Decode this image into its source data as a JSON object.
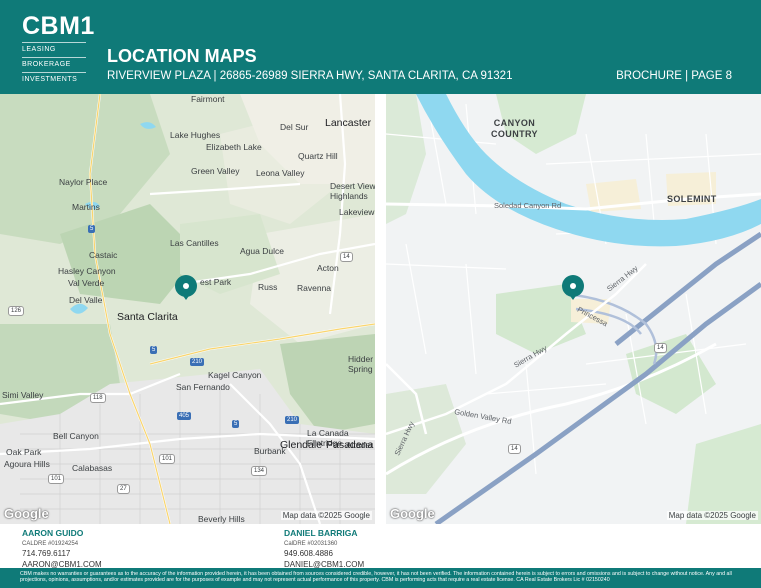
{
  "header": {
    "logo": "CBM1",
    "logo_lines": [
      "LEASING",
      "BROKERAGE",
      "INVESTMENTS"
    ],
    "title": "LOCATION MAPS",
    "subtitle": "RIVERVIEW PLAZA | 26865-26989 SIERRA HWY, SANTA CLARITA, CA 91321",
    "page_label": "BROCHURE | PAGE 8"
  },
  "map_left": {
    "labels": {
      "fairmont": "Fairmont",
      "lancaster": "Lancaster",
      "delsur": "Del Sur",
      "lakehughes": "Lake Hughes",
      "elizabethlake": "Elizabeth Lake",
      "quartzhill": "Quartz Hill",
      "greenvalley": "Green Valley",
      "leonavalley": "Leona Valley",
      "naylorplace": "Naylor Place",
      "desertview": "Desert View\nHighlands",
      "martins": "Martins",
      "lakeview": "Lakeview",
      "lascantilles": "Las Cantilles",
      "aguadulce": "Agua Dulce",
      "castaic": "Castaic",
      "acton": "Acton",
      "hasleycanyon": "Hasley Canyon",
      "forestpark": "est Park",
      "valverde": "Val Verde",
      "russ": "Russ",
      "ravenna": "Ravenna",
      "delvalle": "Del Valle",
      "santaclarita": "Santa Clarita",
      "hidden": "Hidder\nSpring",
      "kagelcanyon": "Kagel Canyon",
      "sanfernando": "San Fernando",
      "simivalley": "Simi Valley",
      "bellcanyon": "Bell Canyon",
      "lacanada": "La Canada\nFlintridge",
      "altadena": "Altader",
      "oakpark": "Oak Park",
      "agourahills": "Agoura Hills",
      "burbank": "Burbank",
      "calabasas": "Calabasas",
      "glendale": "Glendale",
      "pasadena": "Pasadena",
      "beverlyhills": "Beverly Hills"
    },
    "shields": {
      "s5a": "5",
      "s14": "14",
      "s126": "126",
      "s5b": "5",
      "s210": "210",
      "s118": "118",
      "s405": "405",
      "s5c": "5",
      "s210b": "210",
      "s101": "101",
      "s134": "134",
      "s101b": "101",
      "s27": "27"
    },
    "google": "Google",
    "attribution": "Map data ©2025 Google"
  },
  "map_right": {
    "labels": {
      "canyoncountry": "CANYON\nCOUNTRY",
      "solemint": "SOLEMINT",
      "soledad": "Soledad Canyon Rd",
      "sierrahwy1": "Sierra Hwy",
      "princessa": "Princessa",
      "sierrahwy2": "Sierra Hwy",
      "goldenvalley": "Golden Valley Rd",
      "sierrahwy3": "Sierra Hwy"
    },
    "shields": {
      "r14a": "14",
      "r14b": "14"
    },
    "google": "Google",
    "attribution": "Map data ©2025 Google"
  },
  "contacts": [
    {
      "name": "AARON GUIDO",
      "license": "CALDRE #01924254",
      "phone": "714.769.6117",
      "email": "AARON@CBM1.COM"
    },
    {
      "name": "DANIEL BARRIGA",
      "license": "CalDRE #02031360",
      "phone": "949.608.4886",
      "email": "DANIEL@CBM1.COM"
    }
  ],
  "footer": {
    "disclaimer": "CBM makes no warranties or guarantees as to the accuracy of the information provided herein, it has been obtained from sources considered credible, however, it has not been verified. The information contained herein is subject to errors and omissions and is subject to change without notice. Any and all projections, opinions, assumptions, and/or estimates provided are for the purposes of example and may not represent actual performance of this property. CBM is performing acts that require a real estate license. CA Real Estate Brokers Lic # 02150240"
  },
  "colors": {
    "brand": "#0f7a78",
    "water": "#8fd8f0",
    "highway": "#8aa1c4"
  }
}
